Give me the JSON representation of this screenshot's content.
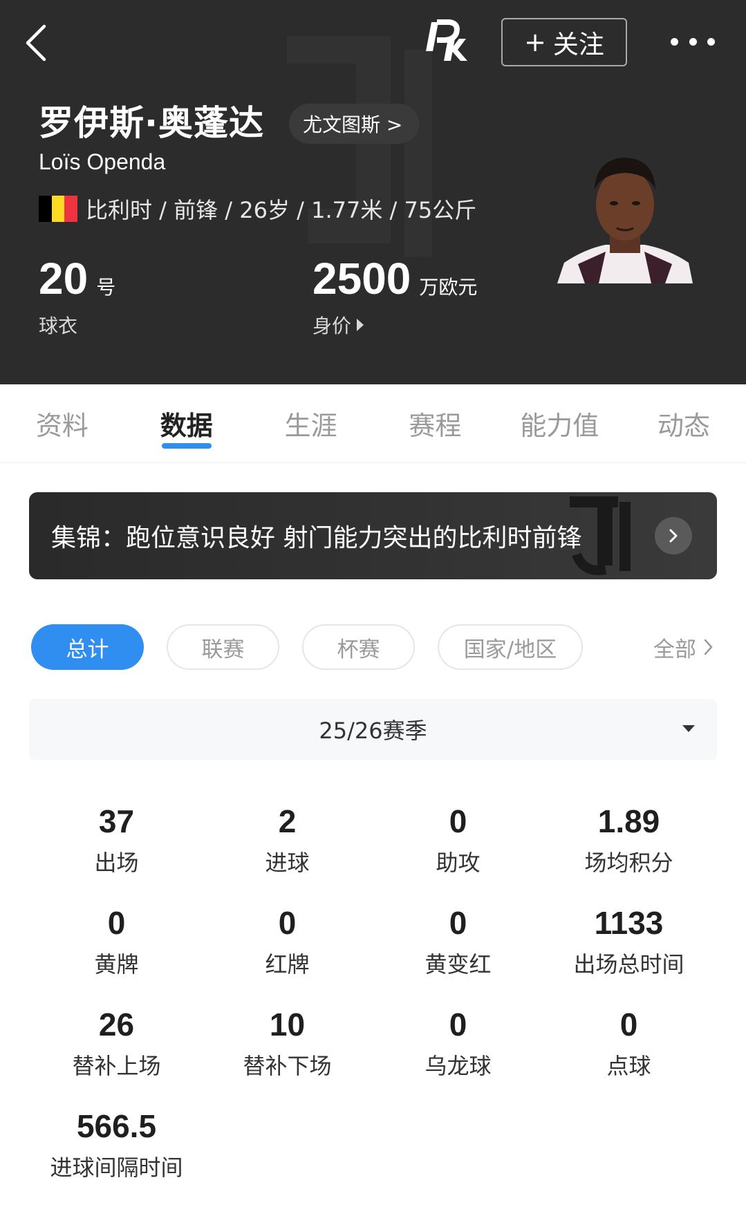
{
  "header": {
    "follow_label": "关注",
    "player_name": "罗伊斯·奥蓬达",
    "club_chip": "尤文图斯 >",
    "player_name_en": "Loïs Openda",
    "info_line": "比利时 / 前锋 / 26岁 / 1.77米 / 75公斤",
    "flag_colors": [
      "#000000",
      "#FDDA24",
      "#EF3340"
    ],
    "jersey": {
      "value": "20",
      "unit": "号",
      "label": "球衣"
    },
    "market_value": {
      "value": "2500",
      "unit": "万欧元",
      "label": "身价"
    },
    "icons": {
      "back": "chevron-left-icon",
      "more": "more-horizontal-icon",
      "logo": "app-logo"
    }
  },
  "tabs": [
    {
      "label": "资料",
      "active": false
    },
    {
      "label": "数据",
      "active": true
    },
    {
      "label": "生涯",
      "active": false
    },
    {
      "label": "赛程",
      "active": false
    },
    {
      "label": "能力值",
      "active": false
    },
    {
      "label": "动态",
      "active": false
    }
  ],
  "banner": {
    "text": "集锦：跑位意识良好 射门能力突出的比利时前锋"
  },
  "filters": {
    "chips": [
      "总计",
      "联赛",
      "杯赛",
      "国家/地区"
    ],
    "active_index": 0,
    "all_label": "全部"
  },
  "season": {
    "selected": "25/26赛季"
  },
  "stats": [
    {
      "value": "37",
      "label": "出场"
    },
    {
      "value": "2",
      "label": "进球"
    },
    {
      "value": "0",
      "label": "助攻"
    },
    {
      "value": "1.89",
      "label": "场均积分"
    },
    {
      "value": "0",
      "label": "黄牌"
    },
    {
      "value": "0",
      "label": "红牌"
    },
    {
      "value": "0",
      "label": "黄变红"
    },
    {
      "value": "1133",
      "label": "出场总时间"
    },
    {
      "value": "26",
      "label": "替补上场"
    },
    {
      "value": "10",
      "label": "替补下场"
    },
    {
      "value": "0",
      "label": "乌龙球"
    },
    {
      "value": "0",
      "label": "点球"
    },
    {
      "value": "566.5",
      "label": "进球间隔时间"
    }
  ],
  "colors": {
    "header_bg": "#2c2c2c",
    "accent": "#2f8ef0"
  }
}
